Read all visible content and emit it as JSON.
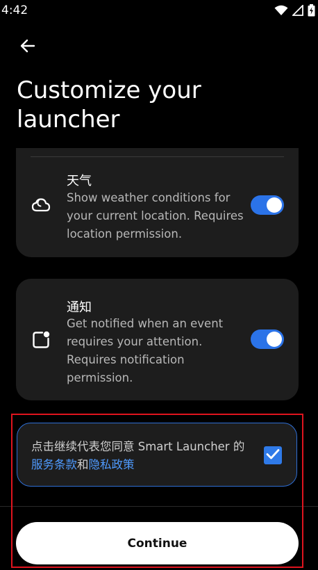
{
  "status_bar": {
    "time": "4:42",
    "icons": [
      "wifi-icon",
      "signal-icon",
      "battery-icon"
    ]
  },
  "header": {
    "back_icon": "arrow-left-icon",
    "title": "Customize your launcher"
  },
  "permissions": [
    {
      "icon": "weather-cloud-icon",
      "title": "天气",
      "description": "Show weather conditions for your current location. Requires location permission.",
      "enabled": true
    },
    {
      "icon": "notification-icon",
      "title": "通知",
      "description": "Get notified when an event requires your attention. Requires notification permission.",
      "enabled": true
    }
  ],
  "consent": {
    "text_before": "点击继续代表您同意 Smart Launcher 的",
    "terms_link": "服务条款",
    "joiner": "和",
    "privacy_link": "隐私政策",
    "checked": true
  },
  "footer": {
    "continue_label": "Continue"
  },
  "colors": {
    "background": "#000000",
    "card": "#1d1d1d",
    "accent": "#2b73e8",
    "link": "#4f9bff",
    "highlight": "#e0141e"
  }
}
